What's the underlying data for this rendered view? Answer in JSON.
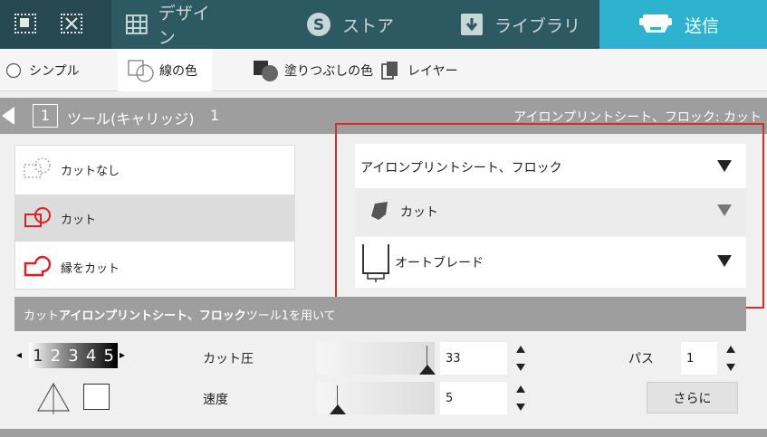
{
  "tabs": [
    {
      "label": "デザイン",
      "icon": "grid-icon"
    },
    {
      "label": "ストア",
      "icon": "s-circle-icon"
    },
    {
      "label": "ライブラリ",
      "icon": "download-icon"
    },
    {
      "label": "送信",
      "icon": "cutter-icon"
    }
  ],
  "toolbar": {
    "simple": "シンプル",
    "line_color": "線の色",
    "fill_color": "塗りつぶしの色",
    "layer": "レイヤー"
  },
  "section": {
    "number": "1",
    "title": "ツール(キャリッジ)",
    "carriage": "1",
    "right_text": "アイロンプリントシート、フロック: カット"
  },
  "cut_options": [
    "カットなし",
    "カット",
    "縁をカット"
  ],
  "dropdowns": {
    "material": "アイロンプリントシート、フロック",
    "action": "カット",
    "tool": "オートブレード"
  },
  "info_bar": {
    "prefix": "カット ",
    "material": "アイロンプリントシート、フロック",
    "suffix": " ツール1を用いて"
  },
  "settings": {
    "blade_digits": [
      "1",
      "2",
      "3",
      "4",
      "5"
    ],
    "force_label": "カット圧",
    "force_value": "33",
    "speed_label": "速度",
    "speed_value": "5",
    "passes_label": "パス",
    "passes_value": "1",
    "more_label": "さらに"
  },
  "colors": {
    "tab_bar": "#2d5a62",
    "active_tab": "#2db3cf",
    "header_gray": "#9e9e9e",
    "highlight_red": "#d32f2f",
    "cut_red": "#e02020"
  }
}
